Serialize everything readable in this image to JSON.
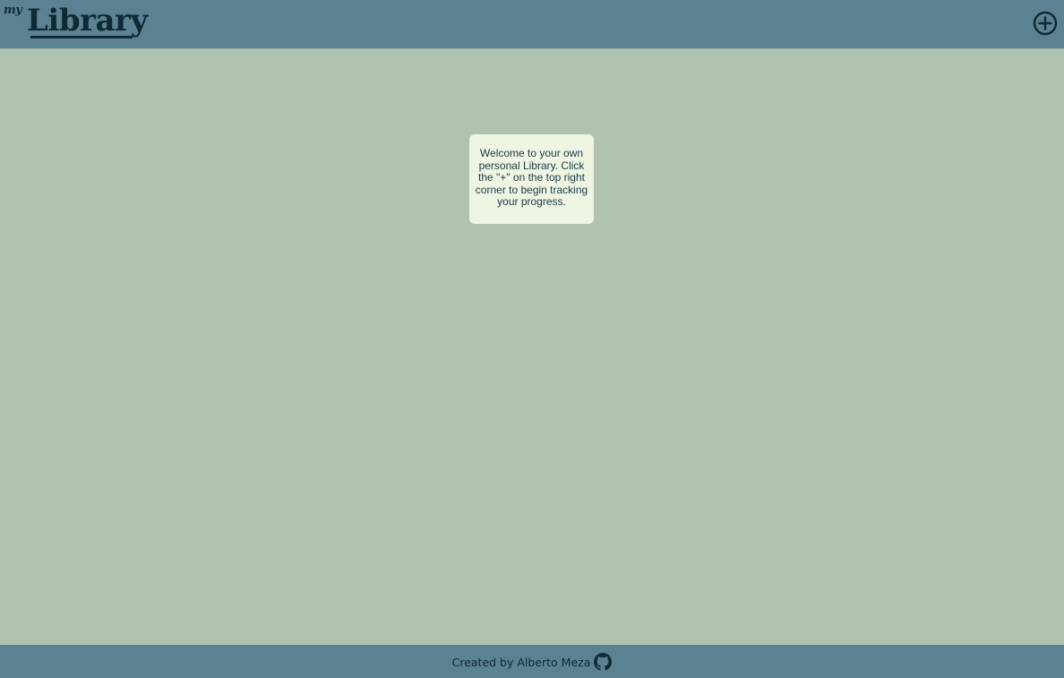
{
  "header": {
    "logo_my": "my",
    "logo_library": "Library",
    "add_icon": "plus-circle-icon"
  },
  "main": {
    "welcome_message": "Welcome to your own personal Library. Click the \"+\" on the top right corner to begin tracking your progress."
  },
  "footer": {
    "credit_text": "Created by Alberto Meza",
    "github_icon": "github-icon"
  },
  "colors": {
    "background": "#afc3b0",
    "bars": "#5a8291",
    "card": "#eef5e3",
    "text_dark": "#0f2a33"
  }
}
